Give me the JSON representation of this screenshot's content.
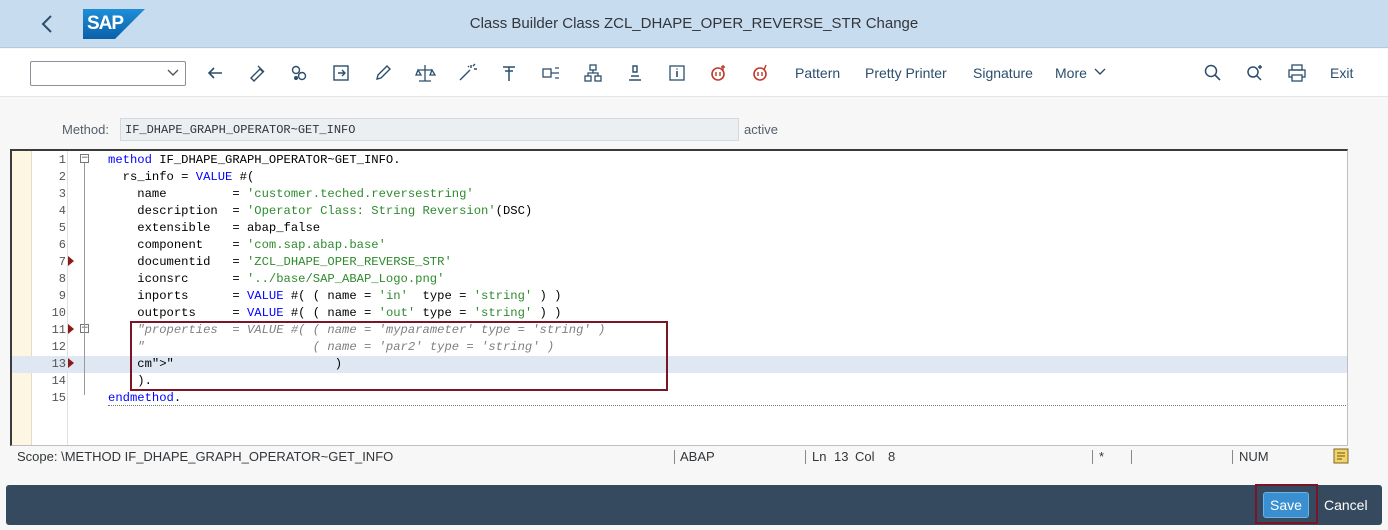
{
  "shell": {
    "logo_text": "SAP",
    "title": "Class Builder Class ZCL_DHAPE_OPER_REVERSE_STR Change"
  },
  "toolbar": {
    "combo_value": "",
    "pattern_label": "Pattern",
    "pretty_printer_label": "Pretty Printer",
    "signature_label": "Signature",
    "more_label": "More",
    "exit_label": "Exit"
  },
  "method": {
    "label": "Method:",
    "value": "IF_DHAPE_GRAPH_OPERATOR~GET_INFO",
    "status": "active"
  },
  "editor": {
    "current_line": 13,
    "lines": [
      {
        "n": "1",
        "text": "method IF_DHAPE_GRAPH_OPERATOR~GET_INFO."
      },
      {
        "n": "2",
        "text": "  rs_info = VALUE #("
      },
      {
        "n": "3",
        "text": "    name         = 'customer.teched.reversestring'"
      },
      {
        "n": "4",
        "text": "    description  = 'Operator Class: String Reversion'(DSC)"
      },
      {
        "n": "5",
        "text": "    extensible   = abap_false"
      },
      {
        "n": "6",
        "text": "    component    = 'com.sap.abap.base'"
      },
      {
        "n": "7",
        "text": "    documentid   = 'ZCL_DHAPE_OPER_REVERSE_STR'"
      },
      {
        "n": "8",
        "text": "    iconsrc      = '../base/SAP_ABAP_Logo.png'"
      },
      {
        "n": "9",
        "text": "    inports      = VALUE #( ( name = 'in'  type = 'string' ) )"
      },
      {
        "n": "10",
        "text": "    outports     = VALUE #( ( name = 'out' type = 'string' ) )"
      },
      {
        "n": "11",
        "text": "    \"properties  = VALUE #( ( name = 'myparameter' type = 'string' )"
      },
      {
        "n": "12",
        "text": "    \"                       ( name = 'par2' type = 'string' )"
      },
      {
        "n": "13",
        "text": "    \"                      )"
      },
      {
        "n": "14",
        "text": "    )."
      },
      {
        "n": "15",
        "text": "endmethod."
      }
    ]
  },
  "status": {
    "scope": "Scope: \\METHOD IF_DHAPE_GRAPH_OPERATOR~GET_INFO",
    "language": "ABAP",
    "ln_label": "Ln",
    "ln_value": "13",
    "col_label": "Col",
    "col_value": "8",
    "modified": "*",
    "num": "NUM"
  },
  "footer": {
    "save_label": "Save",
    "cancel_label": "Cancel"
  },
  "colors": {
    "shell_bg": "#c8dcf0",
    "footer_bg": "#354a5f",
    "accent": "#3a8fd0",
    "highlight": "#7a1528",
    "keyword": "#0000ff",
    "string": "#2e8b2e",
    "comment": "#808080"
  }
}
